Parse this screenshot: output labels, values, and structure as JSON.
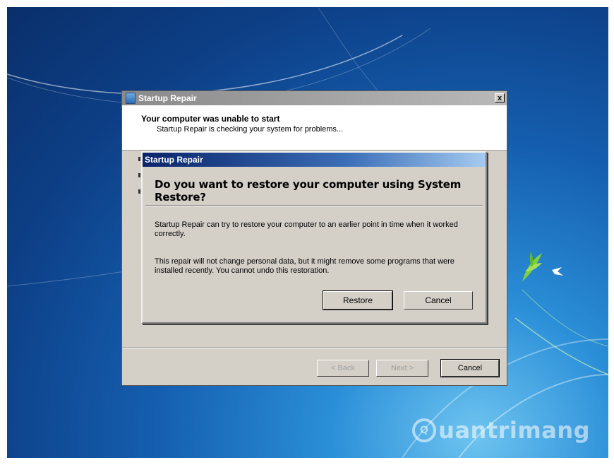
{
  "outer_window": {
    "title": "Startup Repair",
    "close_glyph": "x",
    "header_title": "Your computer was unable to start",
    "header_subtitle": "Startup Repair is checking your system for problems...",
    "buttons": {
      "back": "< Back",
      "next": "Next >",
      "cancel": "Cancel"
    }
  },
  "dialog": {
    "title": "Startup Repair",
    "question": "Do you want to restore your computer using System Restore?",
    "paragraph1": "Startup Repair can try to restore your computer to an earlier point in time when it worked correctly.",
    "paragraph2": "This repair will not change personal data, but it might remove some programs that were installed recently. You cannot undo this restoration.",
    "buttons": {
      "restore": "Restore",
      "cancel": "Cancel"
    }
  },
  "watermark": {
    "text": "uantrimang",
    "ring_glyph": "Q"
  },
  "icons": [
    "window-app-icon",
    "close-icon",
    "watermark-logo-icon",
    "bird-leaf-icon"
  ]
}
